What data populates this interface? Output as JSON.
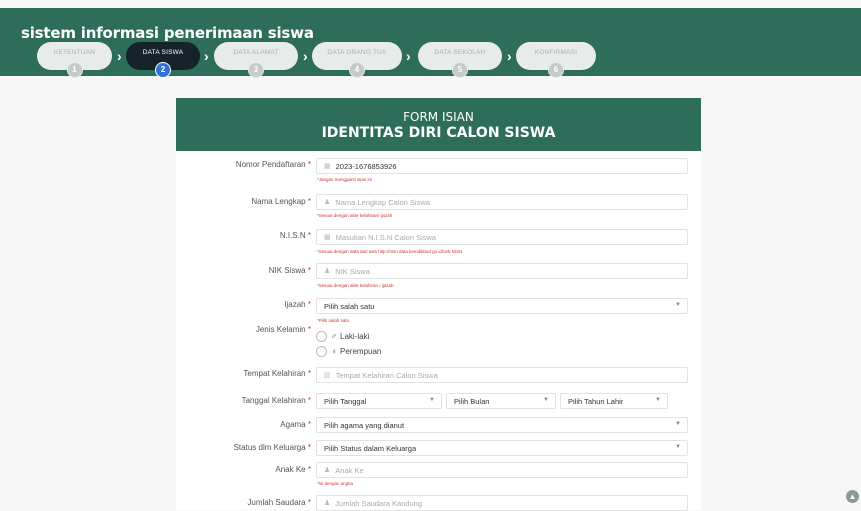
{
  "app": {
    "title": "sistem informasi penerimaan siswa"
  },
  "steps": [
    {
      "label": "KETENTUAN",
      "num": "1"
    },
    {
      "label": "DATA SISWA",
      "num": "2"
    },
    {
      "label": "DATA ALAMAT",
      "num": "3"
    },
    {
      "label": "DATA ORANG TUA",
      "num": "4"
    },
    {
      "label": "DATA SEKOLAH",
      "num": "5"
    },
    {
      "label": "KONFIRMASI",
      "num": "6"
    }
  ],
  "step_separator": "›",
  "form": {
    "title_small": "FORM ISIAN",
    "title_big": "IDENTITAS DIRI CALON SISWA",
    "required_mark": "*",
    "fields": {
      "nomor": {
        "label": "Nomor Pendaftaran",
        "value": "2023-1676853926",
        "hint": "*Jangan mengganti isian ini"
      },
      "nama": {
        "label": "Nama Lengkap",
        "placeholder": "Nama Lengkap Calon Siswa",
        "hint": "*Sesuai dengan akte kelahiran/ ijazah"
      },
      "nisn": {
        "label": "N.I.S.N",
        "placeholder": "Masukan N.I.S.N Calon Siswa",
        "hint": "*Sesuai dengan data dari web http://nisn.data.kemdikbud.go.id/cek-NISN"
      },
      "nik": {
        "label": "NIK Siswa",
        "placeholder": "NIK Siswa",
        "hint": "*Sesuai dengan akte kelahiran / ijazah"
      },
      "ijazah": {
        "label": "Ijazah",
        "value": "Pilih salah satu",
        "hint": "*Pilih salah satu"
      },
      "jk": {
        "label": "Jenis Kelamin",
        "options": [
          "Laki-laki",
          "Perempuan"
        ]
      },
      "tempat": {
        "label": "Tempat Kelahiran",
        "placeholder": "Tempat Kelahiran Calon Siswa"
      },
      "tanggal": {
        "label": "Tanggal Kelahiran",
        "tgl": "Pilih Tanggal",
        "bln": "Pilih Bulan",
        "thn": "Pilih Tahun Lahir"
      },
      "agama": {
        "label": "Agama",
        "value": "Pilih agama yang dianut"
      },
      "status": {
        "label": "Status dlm Keluarga",
        "value": "Pilih Status dalam Keluarga"
      },
      "anak": {
        "label": "Anak Ke",
        "placeholder": "Anak Ke",
        "hint": "*Isi dengan angka"
      },
      "saudara": {
        "label": "Jumlah Saudara",
        "placeholder": "Jumlah Saudara Kandung"
      }
    }
  },
  "icons": {
    "calendar": "calendar-icon",
    "user": "user-icon",
    "card": "id-card-icon",
    "building": "building-icon",
    "caret": "caret-down-icon",
    "up": "arrow-up-icon"
  },
  "colors": {
    "header": "#2d6d5a",
    "active_step": "#17232b",
    "active_num": "#2d74d6",
    "hint": "#cc3333"
  }
}
